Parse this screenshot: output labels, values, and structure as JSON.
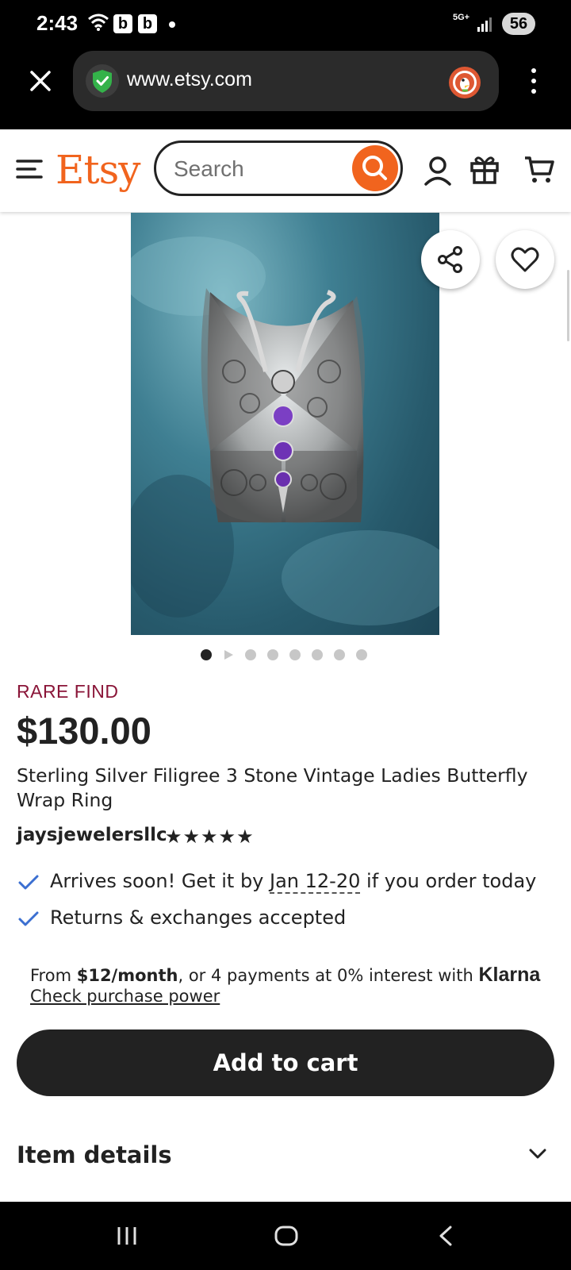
{
  "status_bar": {
    "time": "2:43",
    "badge_1": "b",
    "badge_2": "b",
    "network": "5G+",
    "battery": "56"
  },
  "browser": {
    "url": "www.etsy.com"
  },
  "header": {
    "logo": "Etsy",
    "search_placeholder": "Search"
  },
  "colors": {
    "etsy_orange": "#f1641e",
    "rare_find": "#8a1538",
    "primary_dark": "#222222",
    "check_blue": "#3b6fd1"
  },
  "product": {
    "badge": "RARE FIND",
    "price": "$130.00",
    "title": "Sterling Silver Filigree 3 Stone Vintage Ladies Butterfly Wrap Ring",
    "shop": "jaysjewelersllc",
    "rating_stars": "★★★★★",
    "image_count": 8
  },
  "shipping": {
    "arrives_prefix": "Arrives soon! Get it by ",
    "arrives_dates": "Jan 12-20",
    "arrives_suffix": " if you order today",
    "returns": "Returns & exchanges accepted"
  },
  "klarna": {
    "from": "From ",
    "amount": "$12/month",
    "rest": ", or 4 payments at 0% interest with ",
    "brand": "Klarna",
    "link": "Check purchase power"
  },
  "actions": {
    "add_to_cart": "Add to cart",
    "item_details": "Item details"
  }
}
